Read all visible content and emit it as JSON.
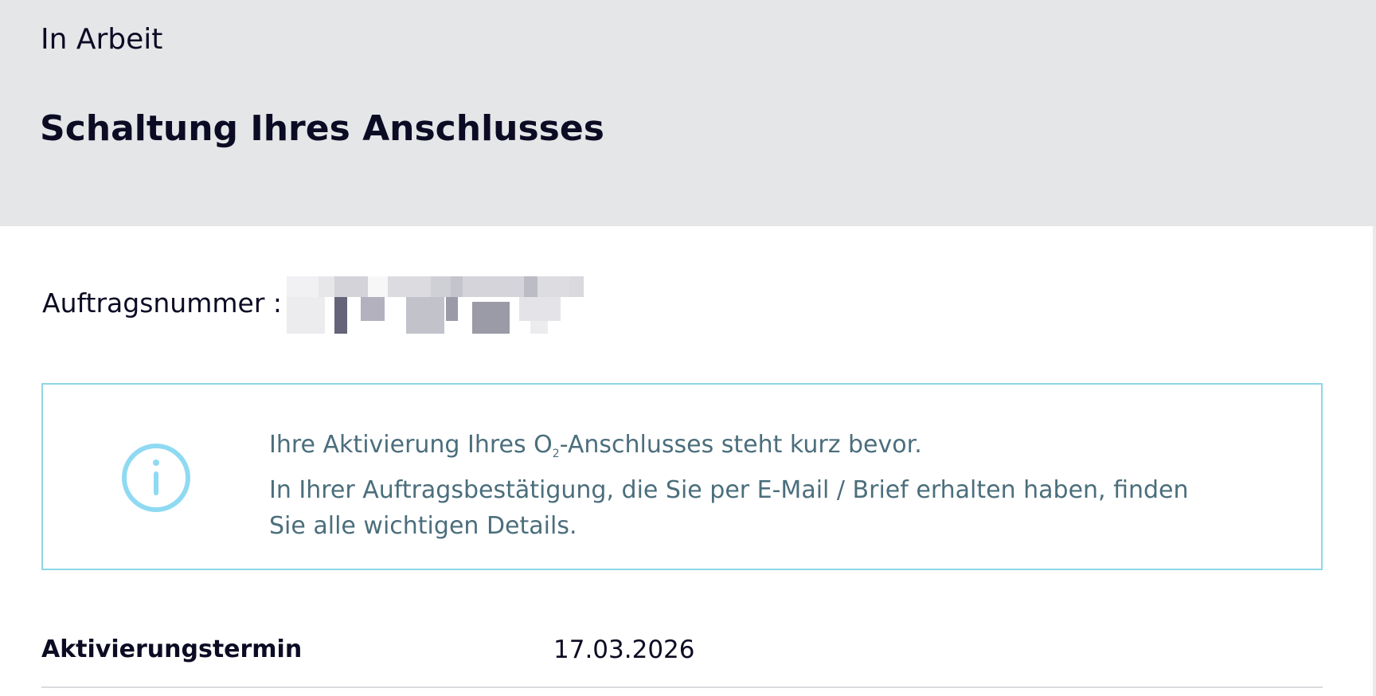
{
  "header": {
    "status": "In Arbeit",
    "title": "Schaltung Ihres Anschlusses"
  },
  "order": {
    "label": "Auftragsnummer :",
    "number_redacted": true
  },
  "info": {
    "icon": "info-icon",
    "line1_before": "Ihre Aktivierung Ihres O",
    "line1_sub": "2",
    "line1_after": "-Anschlusses steht kurz bevor.",
    "line2": "In Ihrer Auftragsbestätigung, die Sie per E-Mail / Brief erhalten haben, finden Sie alle wichtigen Details."
  },
  "details": {
    "activation_label": "Aktivierungstermin",
    "activation_date": "17.03.2026"
  },
  "colors": {
    "header_bg": "#e5e6e8",
    "title_text": "#0c0b24",
    "info_border": "#8ed7e6",
    "info_icon": "#8fdaf2",
    "info_text": "#4b6e7c",
    "divider": "#dadbde"
  }
}
